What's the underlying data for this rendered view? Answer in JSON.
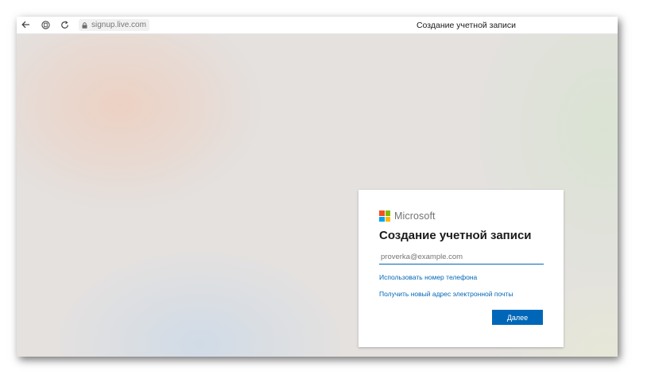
{
  "browser": {
    "url": "signup.live.com",
    "page_title": "Создание учетной записи",
    "icons": {
      "back": "back-arrow-icon",
      "reader": "reader-mode-icon",
      "reload": "reload-icon",
      "lock": "lock-icon"
    }
  },
  "card": {
    "brand": "Microsoft",
    "logo_colors": [
      "#f25022",
      "#7fba00",
      "#00a4ef",
      "#ffb900"
    ],
    "title": "Создание учетной записи",
    "email": {
      "value": "",
      "placeholder": "proverka@example.com"
    },
    "link_phone": "Использовать номер телефона",
    "link_new_email": "Получить новый адрес электронной почты",
    "next_label": "Далее"
  },
  "colors": {
    "accent": "#0067b8"
  }
}
